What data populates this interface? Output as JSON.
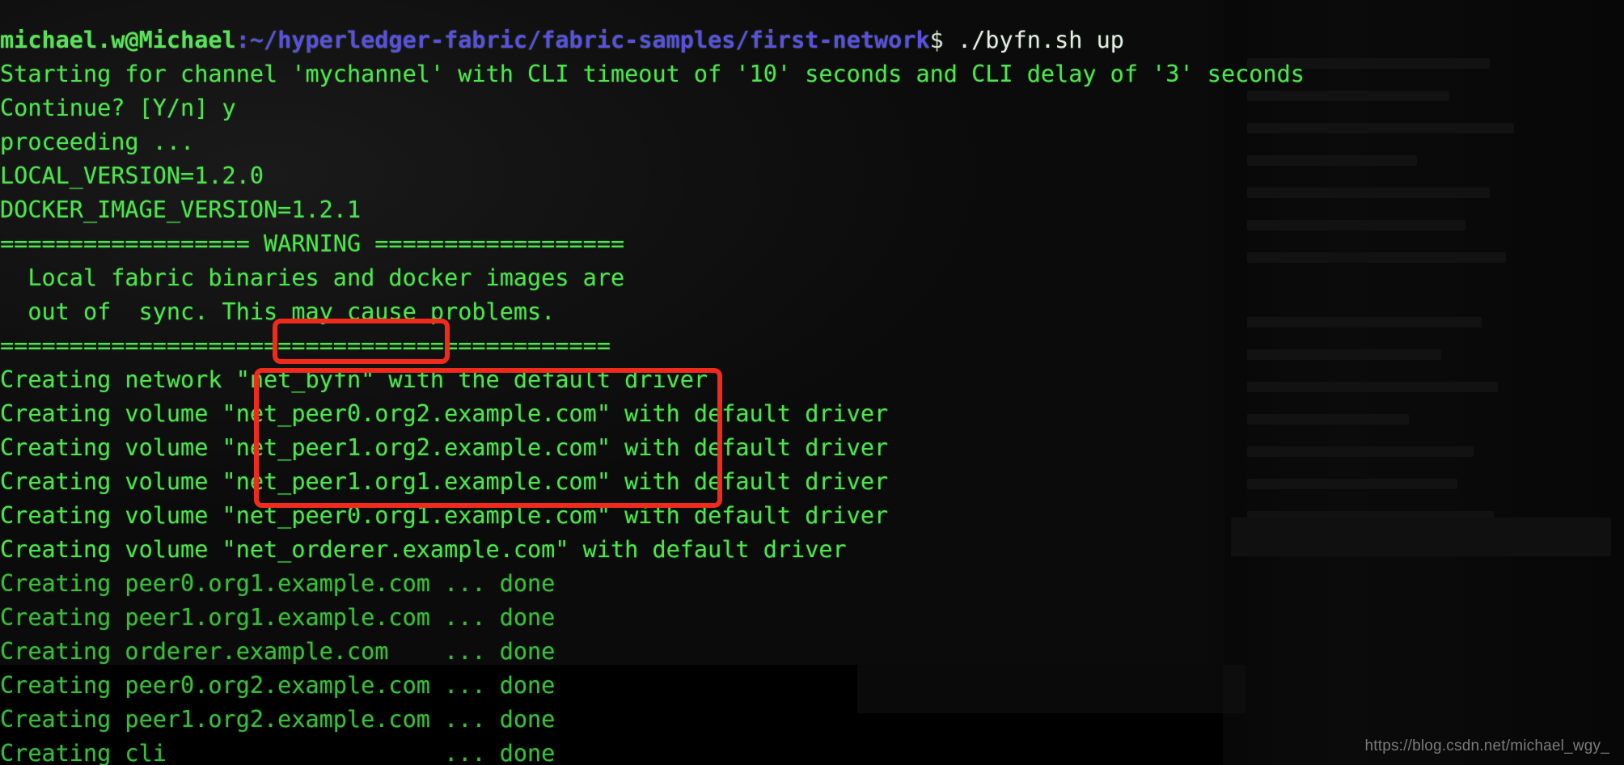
{
  "terminal": {
    "prompt": {
      "user": "michael.w",
      "at": "@",
      "host": "Michael",
      "colon": ":",
      "path": "~/hyperledger-fabric/fabric-samples/first-network",
      "dollar": "$",
      "command": " ./byfn.sh up"
    },
    "lines": [
      "Starting for channel 'mychannel' with CLI timeout of '10' seconds and CLI delay of '3' seconds",
      "Continue? [Y/n] y",
      "proceeding ...",
      "LOCAL_VERSION=1.2.0",
      "DOCKER_IMAGE_VERSION=1.2.1",
      "================== WARNING ==================",
      "  Local fabric binaries and docker images are",
      "  out of  sync. This may cause problems.",
      "============================================",
      "Creating network \"net_byfn\" with the default driver",
      "Creating volume \"net_peer0.org2.example.com\" with default driver",
      "Creating volume \"net_peer1.org2.example.com\" with default driver",
      "Creating volume \"net_peer1.org1.example.com\" with default driver",
      "Creating volume \"net_peer0.org1.example.com\" with default driver",
      "Creating volume \"net_orderer.example.com\" with default driver",
      "Creating peer0.org1.example.com ... done",
      "Creating peer1.org1.example.com ... done",
      "Creating orderer.example.com    ... done",
      "Creating peer0.org2.example.com ... done",
      "Creating peer1.org2.example.com ... done",
      "Creating cli                    ... done"
    ]
  },
  "annotations": {
    "box_1_target": "\"net_byfn\"",
    "box_2_target": "\"net_peer0.org2.example.com\" / \"net_peer1.org2.example.com\" / \"net_peer1.org1.example.com\" / \"net_peer0.org1.example.com\"",
    "box_color": "#f12b1c"
  },
  "watermark": {
    "text": "https://blog.csdn.net/michael_wgy_"
  },
  "colors": {
    "background": "#000000",
    "terminal_background": "#111111",
    "output_green": "#4ee44e",
    "path_blue": "#5b4ee0",
    "prompt_green": "#5ae05a",
    "command_white": "#e8e8e8",
    "annotation_red": "#f12b1c",
    "watermark_gray": "#8f8f8f"
  }
}
